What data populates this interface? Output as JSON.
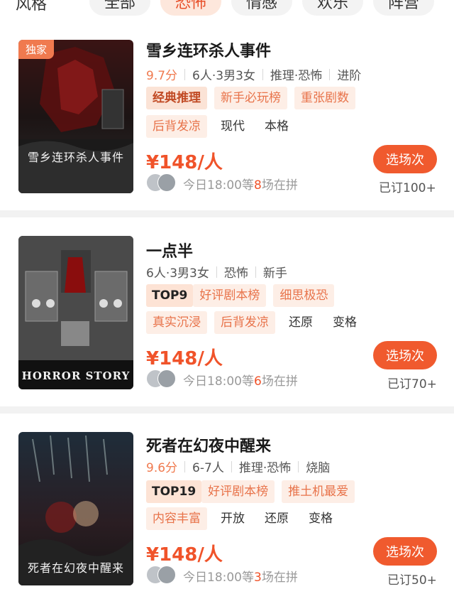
{
  "filter": {
    "label": "风格",
    "chips": [
      "全部",
      "恐怖",
      "情感",
      "欢乐",
      "阵营"
    ],
    "active_index": 1
  },
  "cards": [
    {
      "title": "雪乡连环杀人事件",
      "badge": "独家",
      "poster_caption": "雪乡连环杀人事件",
      "meta": [
        "9.7分",
        "6人·3男3女",
        "推理·恐怖",
        "进阶"
      ],
      "tag_rows": [
        [
          {
            "label": "经典推理",
            "style": "hl"
          },
          {
            "label": "新手必玩榜",
            "style": "soft"
          },
          {
            "label": "重张剧数",
            "style": "soft"
          }
        ],
        [
          {
            "label": "后背发凉",
            "style": "soft"
          },
          {
            "label": "现代",
            "style": "plain"
          },
          {
            "label": "本格",
            "style": "plain"
          }
        ]
      ],
      "price": "¥148/人",
      "session_prefix": "今日18:00等",
      "session_count": "8",
      "session_suffix": "场在拼",
      "cta": "选场次",
      "booked": "已订100+"
    },
    {
      "title": "一点半",
      "badge": "",
      "poster_caption": "HORROR STORY",
      "meta": [
        "6人·3男3女",
        "恐怖",
        "新手"
      ],
      "tag_rows": [
        [
          {
            "label": "TOP9",
            "style": "rank"
          },
          {
            "label": "好评剧本榜",
            "style": "soft"
          },
          {
            "label": "细思极恐",
            "style": "soft"
          }
        ],
        [
          {
            "label": "真实沉浸",
            "style": "soft"
          },
          {
            "label": "后背发凉",
            "style": "soft"
          },
          {
            "label": "还原",
            "style": "plain"
          },
          {
            "label": "变格",
            "style": "plain"
          }
        ]
      ],
      "price": "¥148/人",
      "session_prefix": "今日18:00等",
      "session_count": "6",
      "session_suffix": "场在拼",
      "cta": "选场次",
      "booked": "已订70+"
    },
    {
      "title": "死者在幻夜中醒来",
      "badge": "",
      "poster_caption": "死者在幻夜中醒来",
      "meta": [
        "9.6分",
        "6-7人",
        "推理·恐怖",
        "烧脑"
      ],
      "tag_rows": [
        [
          {
            "label": "TOP19",
            "style": "rank"
          },
          {
            "label": "好评剧本榜",
            "style": "soft"
          },
          {
            "label": "推土机最爱",
            "style": "soft"
          }
        ],
        [
          {
            "label": "内容丰富",
            "style": "soft"
          },
          {
            "label": "开放",
            "style": "plain"
          },
          {
            "label": "还原",
            "style": "plain"
          },
          {
            "label": "变格",
            "style": "plain"
          }
        ]
      ],
      "price": "¥148/人",
      "session_prefix": "今日18:00等",
      "session_count": "3",
      "session_suffix": "场在拼",
      "cta": "选场次",
      "booked": "已订50+"
    }
  ],
  "colors": {
    "accent": "#f05a2e",
    "tag_soft_bg": "#fdeee6",
    "tag_highlight_bg": "#fbe3d6"
  }
}
